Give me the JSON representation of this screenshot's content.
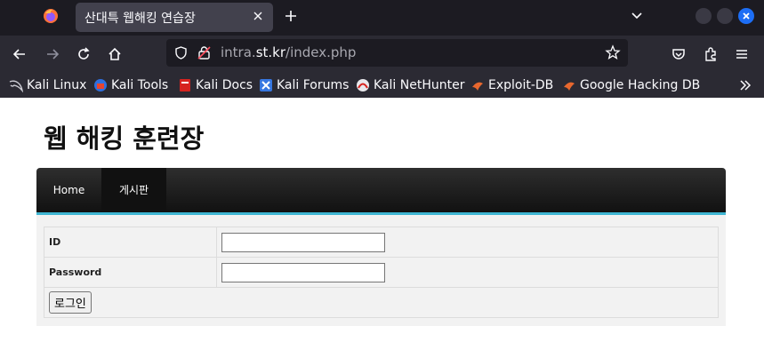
{
  "browser": {
    "tab_title": "산대특 웹해킹 연습장",
    "url_prefix": "intra.",
    "url_host": "st.kr",
    "url_path": "/index.php",
    "bookmarks": [
      {
        "label": "Kali Linux",
        "icon": "kali-dragon-icon"
      },
      {
        "label": "Kali Tools",
        "icon": "kali-tools-icon"
      },
      {
        "label": "Kali Docs",
        "icon": "kali-docs-icon"
      },
      {
        "label": "Kali Forums",
        "icon": "kali-forums-icon"
      },
      {
        "label": "Kali NetHunter",
        "icon": "kali-nethunter-icon"
      },
      {
        "label": "Exploit-DB",
        "icon": "exploit-db-icon"
      },
      {
        "label": "Google Hacking DB",
        "icon": "ghdb-icon"
      }
    ],
    "accent_color": "#1d6ef5"
  },
  "page": {
    "title": "웹 해킹 훈련장",
    "menu": [
      {
        "label": "Home"
      },
      {
        "label": "게시판"
      }
    ],
    "menu_accent_color": "#3fb6d3",
    "form": {
      "id_label": "ID",
      "id_value": "",
      "password_label": "Password",
      "password_value": "",
      "login_button": "로그인"
    }
  }
}
